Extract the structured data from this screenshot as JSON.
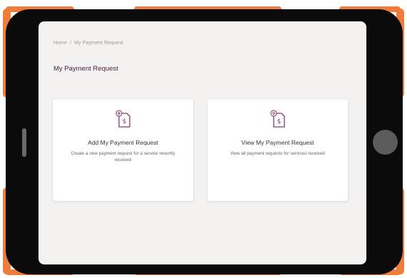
{
  "colors": {
    "bumper": "#f07c3c",
    "device": "#0b0b0b",
    "screen_bg": "#f4f2f1",
    "accent": "#4a2340",
    "icon_accent": "#7b3f6e"
  },
  "breadcrumb": {
    "home": "Home",
    "separator": "/",
    "current": "My Payment Request"
  },
  "page": {
    "title": "My Payment Request"
  },
  "cards": [
    {
      "title": "Add My Payment Request",
      "description": "Create a new payment request for a service recently received",
      "icon": "add-payment-request-icon"
    },
    {
      "title": "View My Payment Request",
      "description": "View all payment requests for services received",
      "icon": "view-payment-request-icon"
    }
  ]
}
